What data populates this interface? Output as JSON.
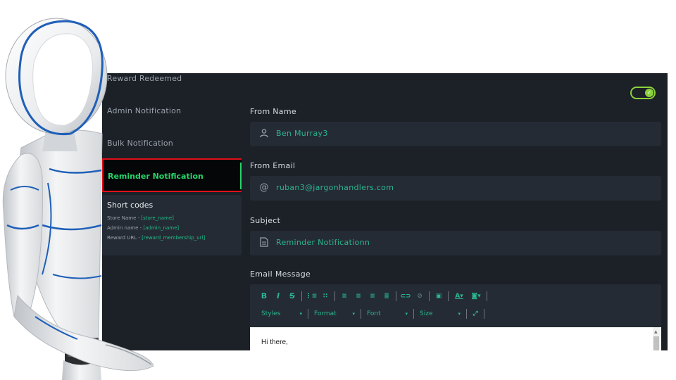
{
  "sidebar": {
    "items": [
      {
        "label": "Reward Redeemed"
      },
      {
        "label": "Admin Notification"
      },
      {
        "label": "Bulk Notification"
      },
      {
        "label": "Reminder Notification",
        "active": true
      }
    ],
    "short_codes": {
      "title": "Short codes",
      "lines": [
        {
          "label": "Store Name - ",
          "code": "[store_name]"
        },
        {
          "label": "Admin name - ",
          "code": "[admin_name]"
        },
        {
          "label": "Reward URL - ",
          "code": "[reward_membership_url]"
        }
      ]
    }
  },
  "main": {
    "toggle": {
      "enabled": true
    },
    "from_name": {
      "label": "From Name",
      "value": "Ben Murray3",
      "icon": "user-icon"
    },
    "from_email": {
      "label": "From Email",
      "value": "ruban3@jargonhandlers.com",
      "icon": "at-icon"
    },
    "subject": {
      "label": "Subject",
      "value": "Reminder Notificationn",
      "icon": "document-icon"
    },
    "email_message": {
      "label": "Email Message",
      "toolbar": {
        "bold": "B",
        "italic": "I",
        "strike": "S",
        "combos": [
          {
            "label": "Styles"
          },
          {
            "label": "Format"
          },
          {
            "label": "Font"
          },
          {
            "label": "Size"
          }
        ]
      },
      "content": "Hi there,"
    }
  },
  "colors": {
    "accent": "#2ab58e",
    "active_green": "#27d46a",
    "highlight_red": "#e0101a",
    "panel_bg": "#1c2027",
    "field_bg": "#252b34"
  }
}
